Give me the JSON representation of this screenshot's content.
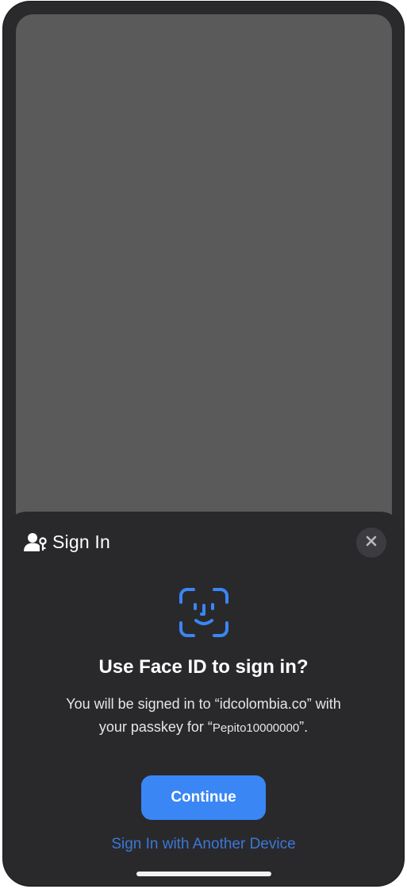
{
  "sheet": {
    "title": "Sign In",
    "close_icon": "xmark-icon",
    "header_icon": "person-key-icon",
    "faceid_icon": "faceid-icon",
    "question": "Use Face ID to sign in?",
    "detail_line1": "You will be signed in to “idcolombia.co” with",
    "detail_line2_prefix": "your passkey for “",
    "detail_user": "Pepito10000000",
    "detail_line2_suffix": "”.",
    "continue_label": "Continue",
    "alt_device_label": "Sign In with Another Device"
  },
  "colors": {
    "accent": "#3a86f5",
    "link": "#3b78d6",
    "sheet_bg": "#29292c",
    "screen_bg": "#5a5a5a"
  }
}
